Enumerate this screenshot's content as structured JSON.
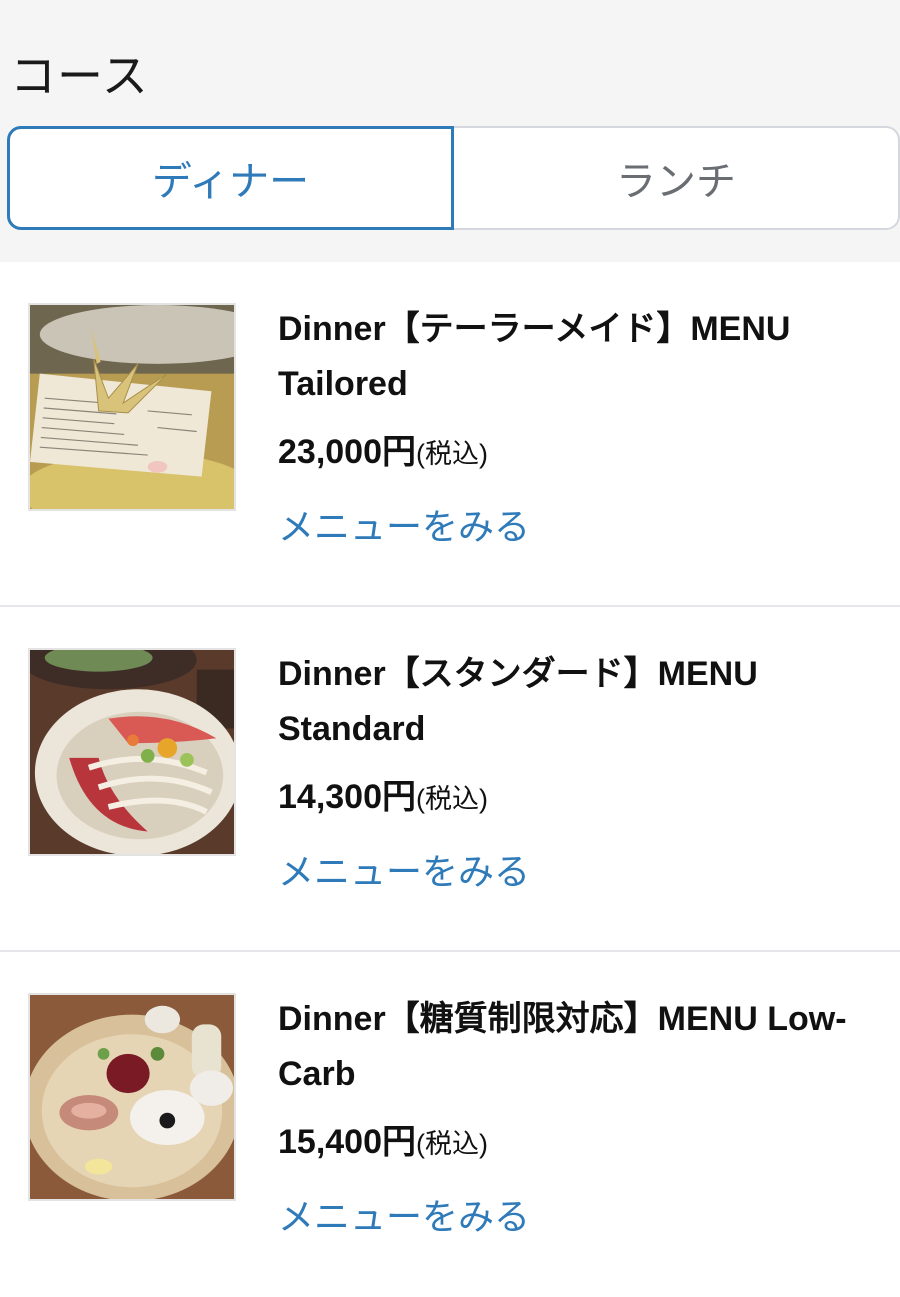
{
  "header": {
    "title": "コース"
  },
  "tabs": [
    {
      "label": "ディナー",
      "active": true
    },
    {
      "label": "ランチ",
      "active": false
    }
  ],
  "courses": [
    {
      "title": "Dinner【テーラーメイド】MENU Tailored",
      "price": "23,000円",
      "tax": "(税込)",
      "link": "メニューをみる",
      "image": "paper-crane-menu-photo"
    },
    {
      "title": "Dinner【スタンダード】MENU Standard",
      "price": "14,300円",
      "tax": "(税込)",
      "link": "メニューをみる",
      "image": "tuna-salad-bowl-photo"
    },
    {
      "title": "Dinner【糖質制限対応】MENU Low-Carb",
      "price": "15,400円",
      "tax": "(税込)",
      "link": "メニューをみる",
      "image": "appetizer-plate-photo"
    }
  ],
  "colors": {
    "accent": "#2f7ab9",
    "inactive_tab_text": "#6a6e73",
    "top_background": "#f5f5f5"
  }
}
